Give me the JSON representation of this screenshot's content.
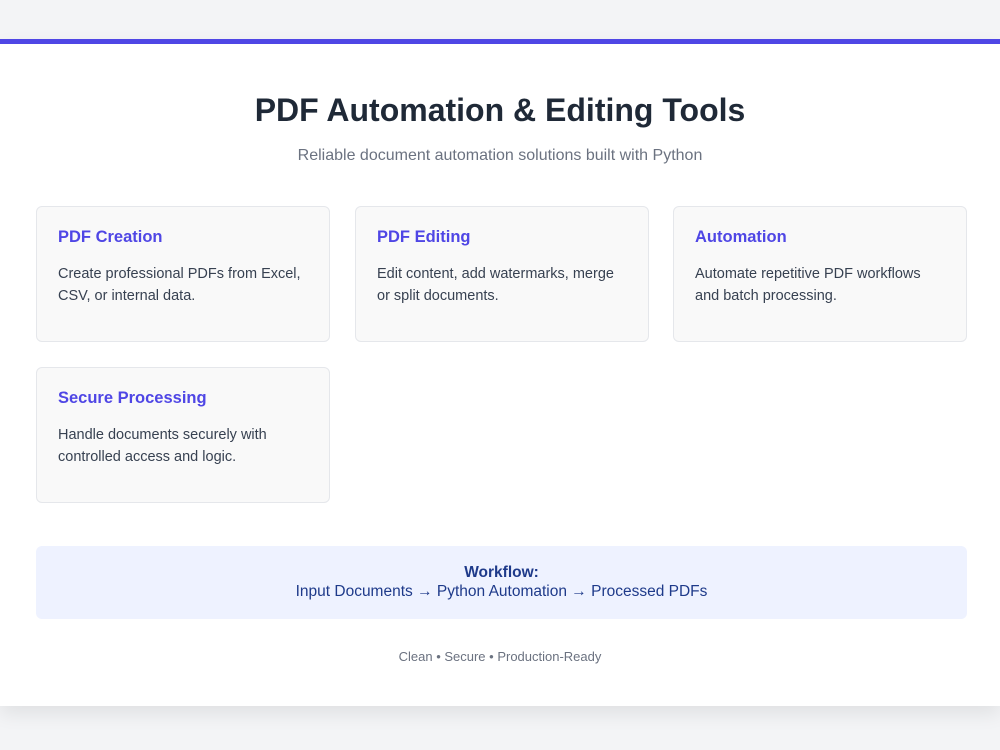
{
  "header": {
    "title": "PDF Automation & Editing Tools",
    "subtitle": "Reliable document automation solutions built with Python"
  },
  "features": [
    {
      "title": "PDF Creation",
      "description": "Create professional PDFs from Excel, CSV, or internal data."
    },
    {
      "title": "PDF Editing",
      "description": "Edit content, add watermarks, merge or split documents."
    },
    {
      "title": "Automation",
      "description": "Automate repetitive PDF workflows and batch processing."
    },
    {
      "title": "Secure Processing",
      "description": "Handle documents securely with controlled access and logic."
    }
  ],
  "workflow": {
    "label": "Workflow:",
    "steps": "Input Documents → Python Automation → Processed PDFs"
  },
  "footer": {
    "text": "Clean • Secure • Production-Ready"
  },
  "colors": {
    "accent": "#4f46e5",
    "background": "#f3f4f6",
    "card": "#ffffff",
    "workflow_bg": "#eef2ff"
  }
}
